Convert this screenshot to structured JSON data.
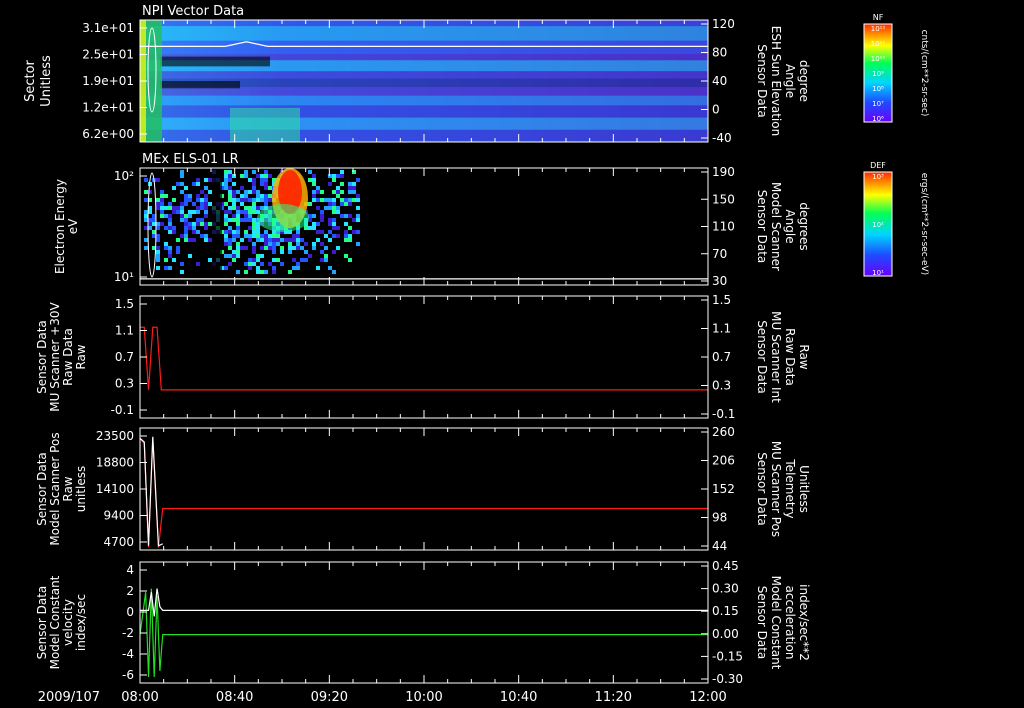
{
  "date_label": "2009/107",
  "time_ticks": [
    "08:00",
    "08:40",
    "09:20",
    "10:00",
    "10:40",
    "11:20",
    "12:00"
  ],
  "colorbars": [
    {
      "label": "NF",
      "units": "cnts/(cm**2-sr-sec)",
      "ticks": [
        "10¹²",
        "10¹¹",
        "10¹⁰",
        "10⁹",
        "10⁸",
        "10⁷",
        "10⁶"
      ]
    },
    {
      "label": "DEF",
      "units": "ergs/(cm**2-sr-sec-eV)",
      "ticks": [
        "10³",
        "10²",
        "10¹"
      ]
    }
  ],
  "colors": {
    "white": "#ffffff",
    "red": "#ff1a1a",
    "green": "#22dd22"
  },
  "chart_data": [
    {
      "type": "heatmap",
      "title": "NPI Vector Data",
      "ylabel_lines": [
        "Sector",
        "Unitless"
      ],
      "y_ticks": [
        "3.1e+01",
        "2.5e+01",
        "1.9e+01",
        "1.2e+01",
        "6.2e+00"
      ],
      "right_ylabel_lines": [
        "Sensor Data",
        "ESH Sun Elevation",
        "Angle",
        "degree"
      ],
      "right_ticks": [
        "120",
        "80",
        "40",
        "0",
        "-40"
      ],
      "right_ylim": [
        -65,
        120
      ],
      "overlay_series": {
        "x_hours": [
          8.0,
          8.6,
          8.75,
          8.9,
          9.1,
          9.3,
          12.0
        ],
        "values": [
          80,
          80,
          87,
          80,
          80,
          80,
          80
        ]
      }
    },
    {
      "type": "heatmap",
      "title": "MEx ELS-01 LR",
      "ylabel_lines": [
        "Electron Energy",
        "eV"
      ],
      "y_ticks": [
        "10²",
        "10¹"
      ],
      "right_ylabel_lines": [
        "Sensor Data",
        "Model Scanner",
        "Angle",
        "degrees"
      ],
      "right_ticks": [
        "190",
        "150",
        "110",
        "70",
        "30"
      ],
      "right_ylim": [
        0,
        190
      ],
      "overlay_series": {
        "x_hours": [
          8.0,
          12.0
        ],
        "values": [
          10,
          10
        ]
      }
    },
    {
      "type": "line",
      "ylabel_lines": [
        "Sensor Data",
        "MU Scanner +30V",
        "Raw Data",
        "Raw"
      ],
      "y_ticks": [
        "1.5",
        "1.1",
        "0.7",
        "0.3",
        "-0.1"
      ],
      "ylim": [
        -0.45,
        1.5
      ],
      "right_ylabel_lines": [
        "Sensor Data",
        "MU Scanner Int",
        "Raw Data",
        "Raw"
      ],
      "right_ticks": [
        "1.5",
        "1.1",
        "0.7",
        "0.3",
        "-0.1"
      ],
      "series": [
        {
          "color": "#ff1a1a",
          "x_hours": [
            8.0,
            8.03,
            8.06,
            8.09,
            8.12,
            8.15,
            8.18,
            12.0
          ],
          "values": [
            1.0,
            1.0,
            0.0,
            1.0,
            1.0,
            0.0,
            0.0,
            0.0
          ]
        }
      ]
    },
    {
      "type": "line",
      "ylabel_lines": [
        "Sensor Data",
        "Model Scanner Pos",
        "Raw",
        "unitless"
      ],
      "y_ticks": [
        "23500",
        "18800",
        "14100",
        "9400",
        "4700"
      ],
      "ylim": [
        0,
        23500
      ],
      "right_ylabel_lines": [
        "Sensor Data",
        "MU Scanner Pos",
        "Telemetry",
        "Unitless"
      ],
      "right_ticks": [
        "260",
        "206",
        "152",
        "98",
        "44"
      ],
      "series": [
        {
          "color": "#ff1a1a",
          "x_hours": [
            8.0,
            8.03,
            8.06,
            8.09,
            8.13,
            8.16,
            8.2,
            12.0
          ],
          "values": [
            21500,
            20500,
            500,
            21500,
            500,
            8000,
            8000,
            8000
          ]
        },
        {
          "color": "#ffffff",
          "x_hours": [
            8.0,
            8.03,
            8.06,
            8.09,
            8.13,
            8.16
          ],
          "values": [
            21500,
            20800,
            800,
            21800,
            800,
            1200
          ]
        }
      ]
    },
    {
      "type": "line",
      "ylabel_lines": [
        "Sensor Data",
        "Model Constant",
        "velocity",
        "index/sec"
      ],
      "y_ticks": [
        "4",
        "2",
        "0",
        "-2",
        "-4",
        "-6"
      ],
      "ylim": [
        -6,
        4
      ],
      "right_ylabel_lines": [
        "Sensor Data",
        "Model Constant",
        "acceleration",
        "index/sec**2"
      ],
      "right_ticks": [
        "0.45",
        "0.30",
        "0.15",
        "0.00",
        "-0.15",
        "-0.30"
      ],
      "right_ylim": [
        -0.3,
        0.45
      ],
      "series": [
        {
          "color": "#22dd22",
          "x_hours": [
            8.0,
            8.04,
            8.06,
            8.08,
            8.1,
            8.12,
            8.14,
            8.16,
            12.0
          ],
          "values": [
            -2,
            1.5,
            -5.5,
            1.8,
            -5.5,
            1.2,
            -5,
            -2,
            -2
          ]
        },
        {
          "color": "#ffffff",
          "x_hours": [
            8.0,
            8.06,
            8.08,
            8.1,
            8.12,
            8.14,
            8.16,
            12.0
          ],
          "values": [
            0,
            0,
            1.5,
            -0.5,
            1.8,
            0.3,
            0,
            0
          ]
        }
      ]
    }
  ]
}
